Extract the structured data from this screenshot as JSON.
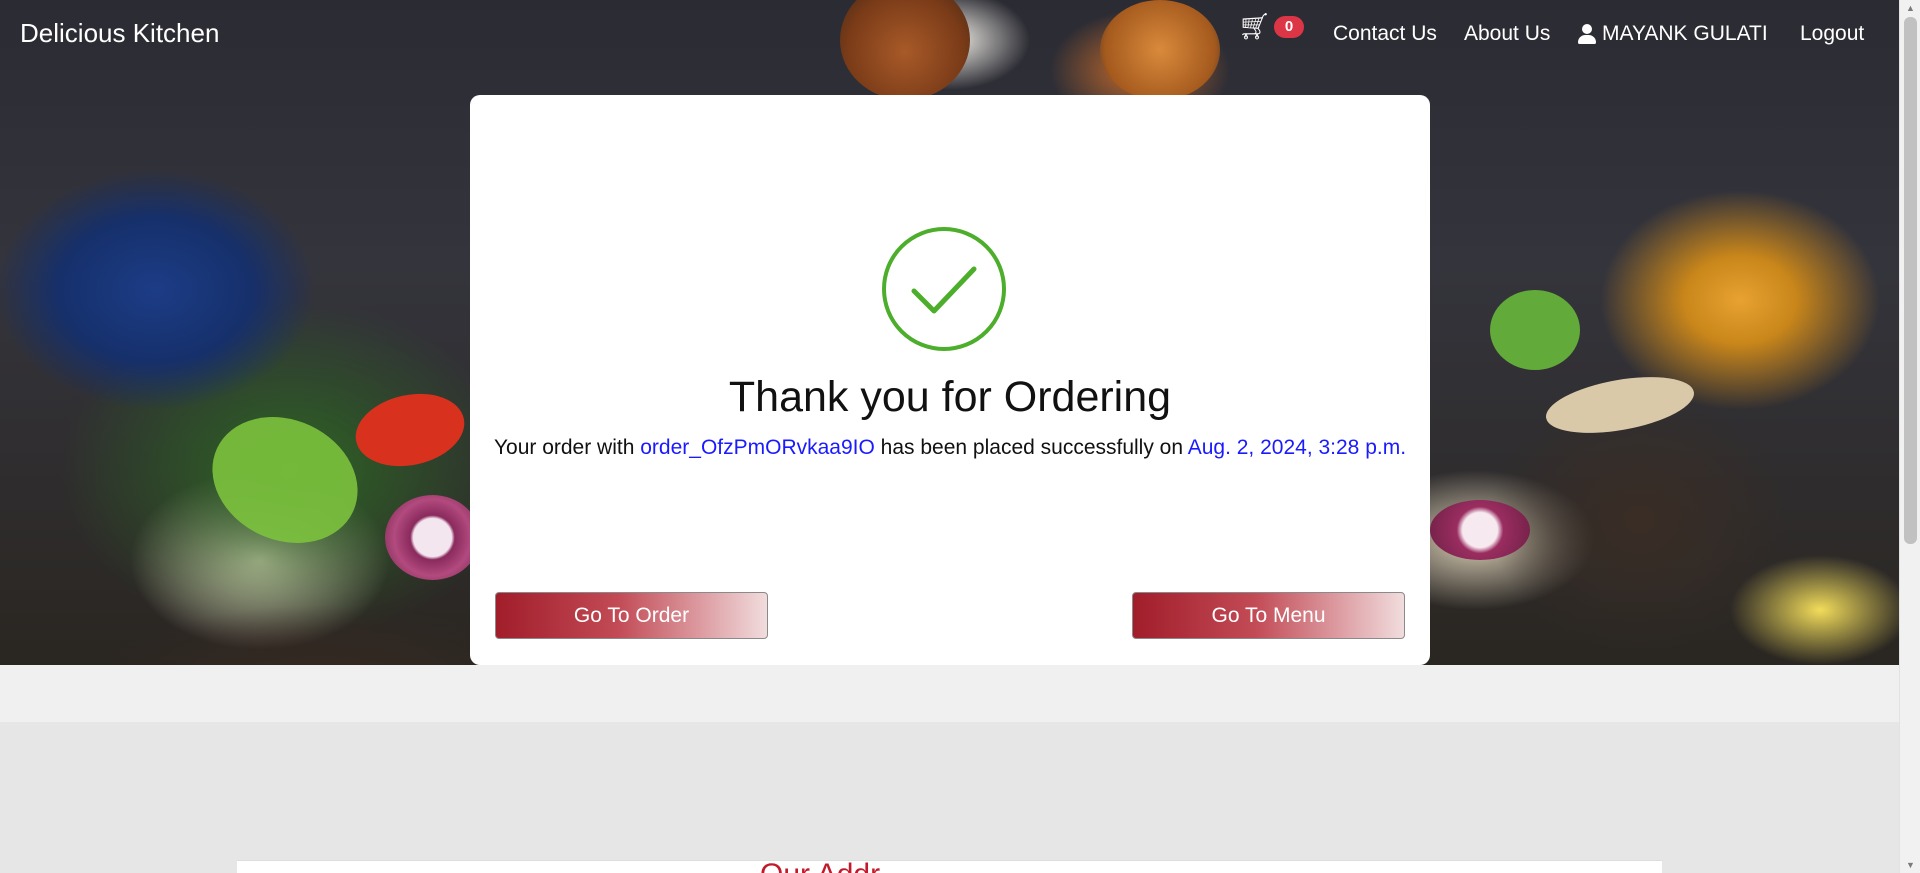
{
  "navbar": {
    "brand": "Delicious Kitchen",
    "cart_icon": "cart-icon",
    "cart_count": "0",
    "contact_label": "Contact Us",
    "about_label": "About Us",
    "user_icon": "user-icon",
    "user_name": "MAYANK GULATI",
    "logout_label": "Logout"
  },
  "confirmation": {
    "icon": "check-circle-icon",
    "title": "Thank you for Ordering",
    "message_prefix": "Your order with ",
    "order_id": "order_OfzPmORvkaa9IO",
    "message_middle": " has been placed successfully on ",
    "placed_at": "Aug. 2, 2024, 3:28 p.m.",
    "go_to_order_label": "Go To Order",
    "go_to_menu_label": "Go To Menu"
  },
  "section": {
    "partial_title": "Our Addr"
  },
  "colors": {
    "success": "#4cae2a",
    "link": "#1a1aff",
    "button_start": "#a11d2a",
    "badge": "#dc3545"
  }
}
